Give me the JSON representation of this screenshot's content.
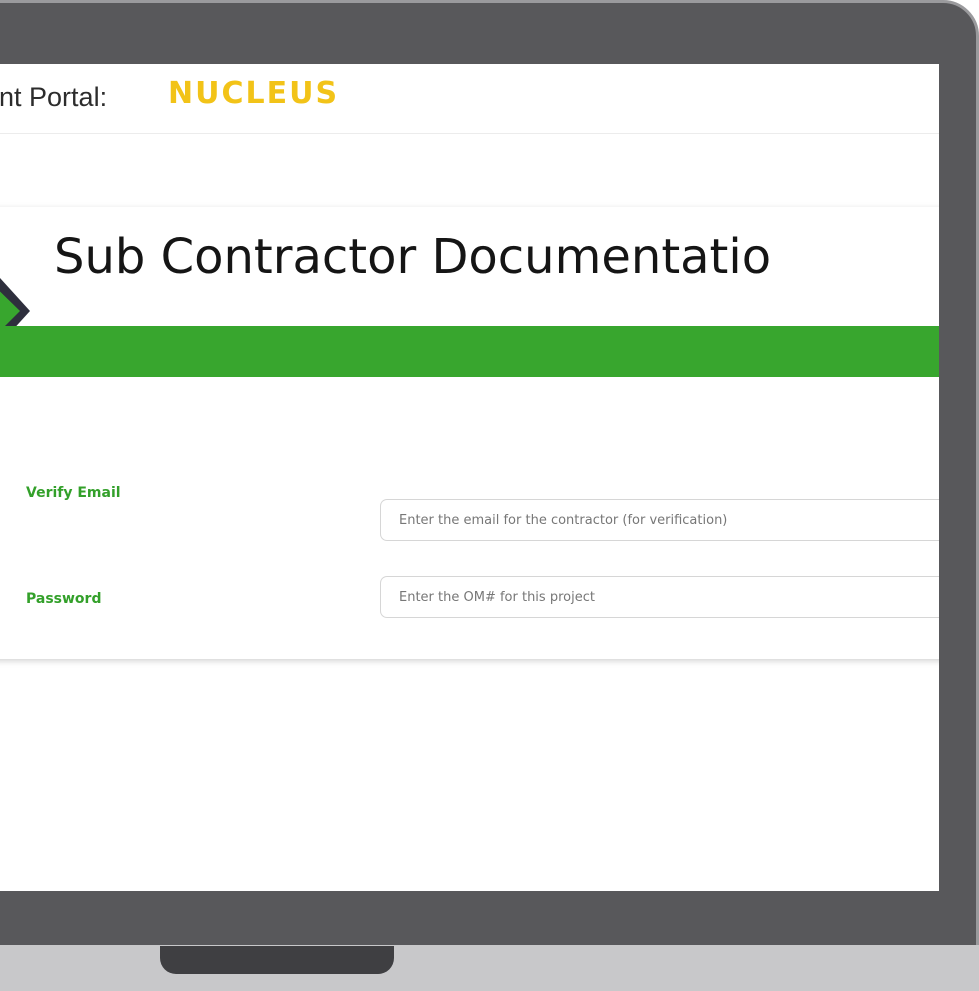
{
  "header": {
    "portal_label": "ent Portal:",
    "brand_name": "NUCLEUS"
  },
  "form": {
    "title": "Sub Contractor Documentatio",
    "fields": [
      {
        "label": "Verify Email",
        "value": "",
        "placeholder": "Enter the email for the contractor (for verification)"
      },
      {
        "label": "Password",
        "value": "",
        "placeholder": "Enter the OM# for this project"
      }
    ]
  },
  "colors": {
    "accent_green": "#38a62e",
    "brand_yellow": "#f2c318",
    "logo_dark": "#2e2f3d",
    "frame_gray": "#58585b"
  }
}
